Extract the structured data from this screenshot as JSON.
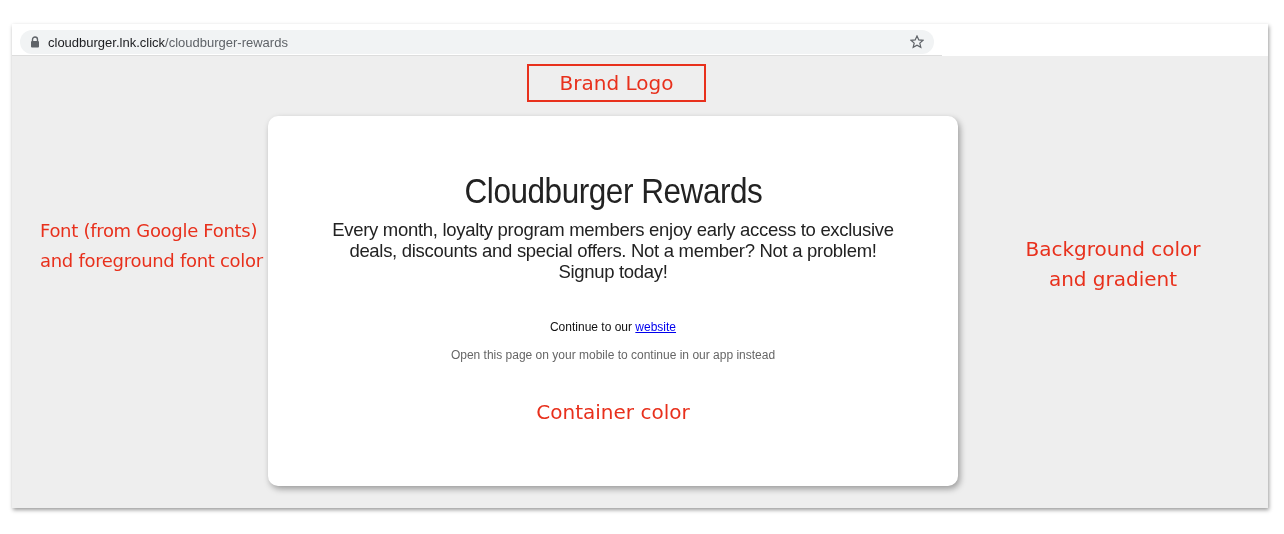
{
  "browser": {
    "url_domain": "cloudburger.lnk.click",
    "url_path": "/cloudburger-rewards",
    "bookmarked": false
  },
  "annotations": [
    {
      "kind": "boxed",
      "lines": [
        "Brand Logo"
      ]
    },
    {
      "kind": "left",
      "lines": [
        "Font (from Google Fonts)",
        "and foreground font color"
      ]
    },
    {
      "kind": "right",
      "lines": [
        "Background color",
        "and gradient"
      ]
    },
    {
      "kind": "card",
      "lines": [
        "Container color"
      ]
    }
  ],
  "card": {
    "title": "Cloudburger Rewards",
    "description": "Every month, loyalty program members enjoy early access to exclusive deals, discounts and special offers. Not a member? Not a problem! Signup today!",
    "continue_text": "Continue to our",
    "continue_link": "website",
    "note": "Open this page on your mobile to continue in our app instead"
  }
}
